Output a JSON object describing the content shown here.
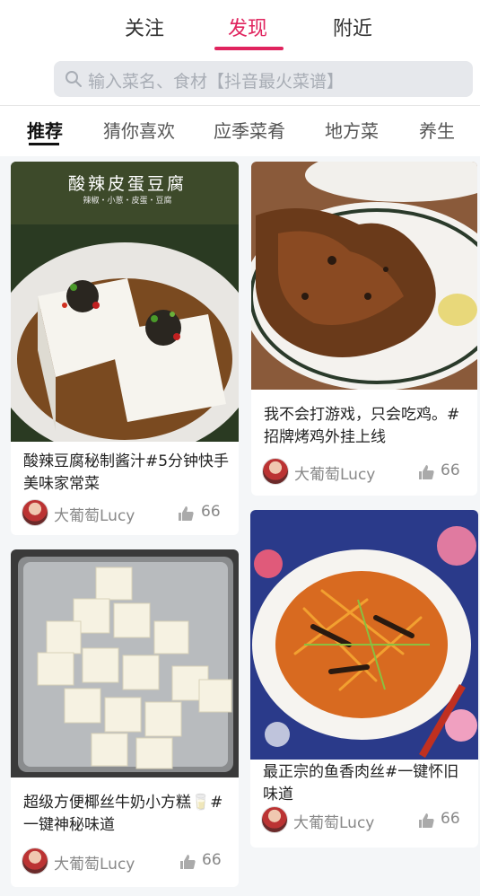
{
  "header": {
    "tabs": [
      {
        "label": "关注"
      },
      {
        "label": "发现"
      },
      {
        "label": "附近"
      }
    ],
    "active_tab": "发现",
    "search_placeholder": "输入菜名、食材【抖音最火菜谱】",
    "accent_color": "#e0245e"
  },
  "categories": [
    {
      "label": "推荐"
    },
    {
      "label": "猜你喜欢"
    },
    {
      "label": "应季菜肴"
    },
    {
      "label": "地方菜"
    },
    {
      "label": "养生"
    }
  ],
  "image_text": {
    "tofu_title": "酸辣皮蛋豆腐",
    "tofu_subtitle": "辣椒・小葱・皮蛋・豆腐"
  },
  "feed": [
    {
      "title": "酸辣豆腐秘制酱汁#5分钟快手美味家常菜",
      "author": "大葡萄Lucy",
      "likes": "66",
      "image": "spicy-tofu-photo"
    },
    {
      "title": "我不会打游戏，只会吃鸡。#招牌烤鸡外挂上线",
      "author": "大葡萄Lucy",
      "likes": "66",
      "image": "roast-chicken-photo"
    },
    {
      "title": "超级方便椰丝牛奶小方糕🥛#一键神秘味道",
      "author": "大葡萄Lucy",
      "likes": "66",
      "image": "milk-cake-photo"
    },
    {
      "title": "最正宗的鱼香肉丝#一键怀旧味道",
      "author": "大葡萄Lucy",
      "likes": "66",
      "image": "yuxiang-pork-photo"
    }
  ]
}
